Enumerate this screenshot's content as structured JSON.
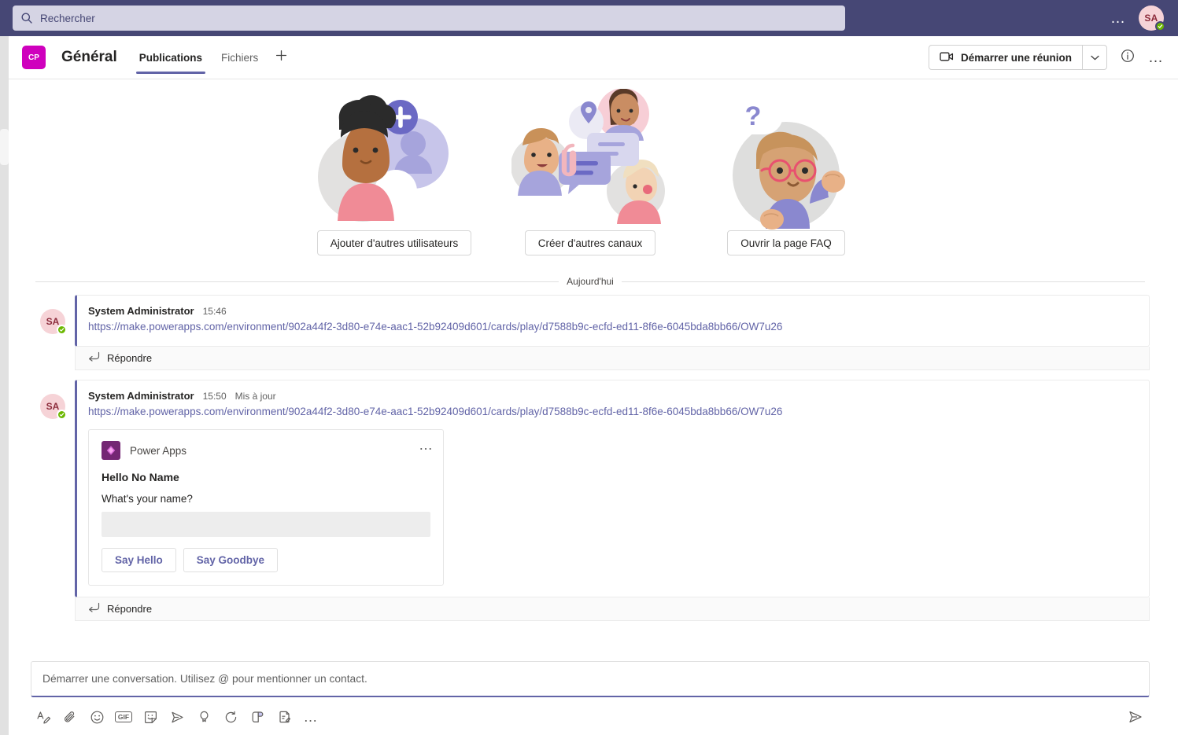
{
  "titlebar": {
    "search": {
      "placeholder": "Rechercher",
      "value": "",
      "icon": "search-icon"
    },
    "more_label": "…",
    "avatar": {
      "initials": "SA",
      "presence": "available"
    }
  },
  "channel_header": {
    "team_avatar_initials": "CP",
    "channel_name": "Général",
    "tabs": [
      {
        "label": "Publications",
        "active": true
      },
      {
        "label": "Fichiers",
        "active": false
      }
    ],
    "add_tab_icon": "plus-icon",
    "meet_button": {
      "label": "Démarrer une réunion",
      "icon": "video-camera-icon",
      "caret_icon": "chevron-down-icon"
    },
    "info_icon": "info-circle-icon",
    "more_label": "…"
  },
  "welcome": {
    "cards": [
      {
        "illustration": "add-members-illustration",
        "button_label": "Ajouter d'autres utilisateurs"
      },
      {
        "illustration": "channels-conversation-illustration",
        "button_label": "Créer d'autres canaux"
      },
      {
        "illustration": "faq-question-illustration",
        "button_label": "Ouvrir la page FAQ"
      }
    ]
  },
  "day_divider": {
    "label": "Aujourd'hui"
  },
  "messages": [
    {
      "avatar_initials": "SA",
      "author": "System Administrator",
      "time": "15:46",
      "edited_label": "",
      "link": "https://make.powerapps.com/environment/902a44f2-3d80-e74e-aac1-52b92409d601/cards/play/d7588b9c-ecfd-ed11-8f6e-6045bda8bb66/OW7u26",
      "reply_label": "Répondre",
      "reply_icon": "reply-arrow-icon"
    },
    {
      "avatar_initials": "SA",
      "author": "System Administrator",
      "time": "15:50",
      "edited_label": "Mis à jour",
      "link": "https://make.powerapps.com/environment/902a44f2-3d80-e74e-aac1-52b92409d601/cards/play/d7588b9c-ecfd-ed11-8f6e-6045bda8bb66/OW7u26",
      "reply_label": "Répondre",
      "reply_icon": "reply-arrow-icon"
    }
  ],
  "power_apps_card": {
    "app_name": "Power Apps",
    "logo_icon": "power-apps-icon",
    "more_label": "…",
    "title": "Hello No Name",
    "question": "What's your name?",
    "input_value": "",
    "input_placeholder": "",
    "buttons": [
      {
        "label": "Say Hello"
      },
      {
        "label": "Say Goodbye"
      }
    ]
  },
  "compose": {
    "placeholder": "Démarrer une conversation. Utilisez @ pour mentionner un contact.",
    "value": "",
    "toolbar": [
      {
        "icon": "format-text-icon",
        "title": "Format"
      },
      {
        "icon": "attach-paperclip-icon",
        "title": "Joindre"
      },
      {
        "icon": "emoji-smiley-icon",
        "title": "Emoji"
      },
      {
        "icon": "gif-icon",
        "title": "GIF"
      },
      {
        "icon": "sticker-icon",
        "title": "Autocollant"
      },
      {
        "icon": "schedule-send-icon",
        "title": "Envoyer plus tard"
      },
      {
        "icon": "praise-badge-icon",
        "title": "Compliment"
      },
      {
        "icon": "loop-refresh-icon",
        "title": "Loop"
      },
      {
        "icon": "apps-icon",
        "title": "Applications"
      },
      {
        "icon": "approvals-icon",
        "title": "Approbations"
      },
      {
        "icon": "more-options-icon",
        "title": "…"
      }
    ],
    "send_icon": "send-paper-plane-icon"
  },
  "colors": {
    "brand_purple": "#6264a7",
    "titlebar": "#464775",
    "team_avatar": "#cf00bd",
    "power_apps_logo": "#742774",
    "presence_green": "#6bb700"
  }
}
